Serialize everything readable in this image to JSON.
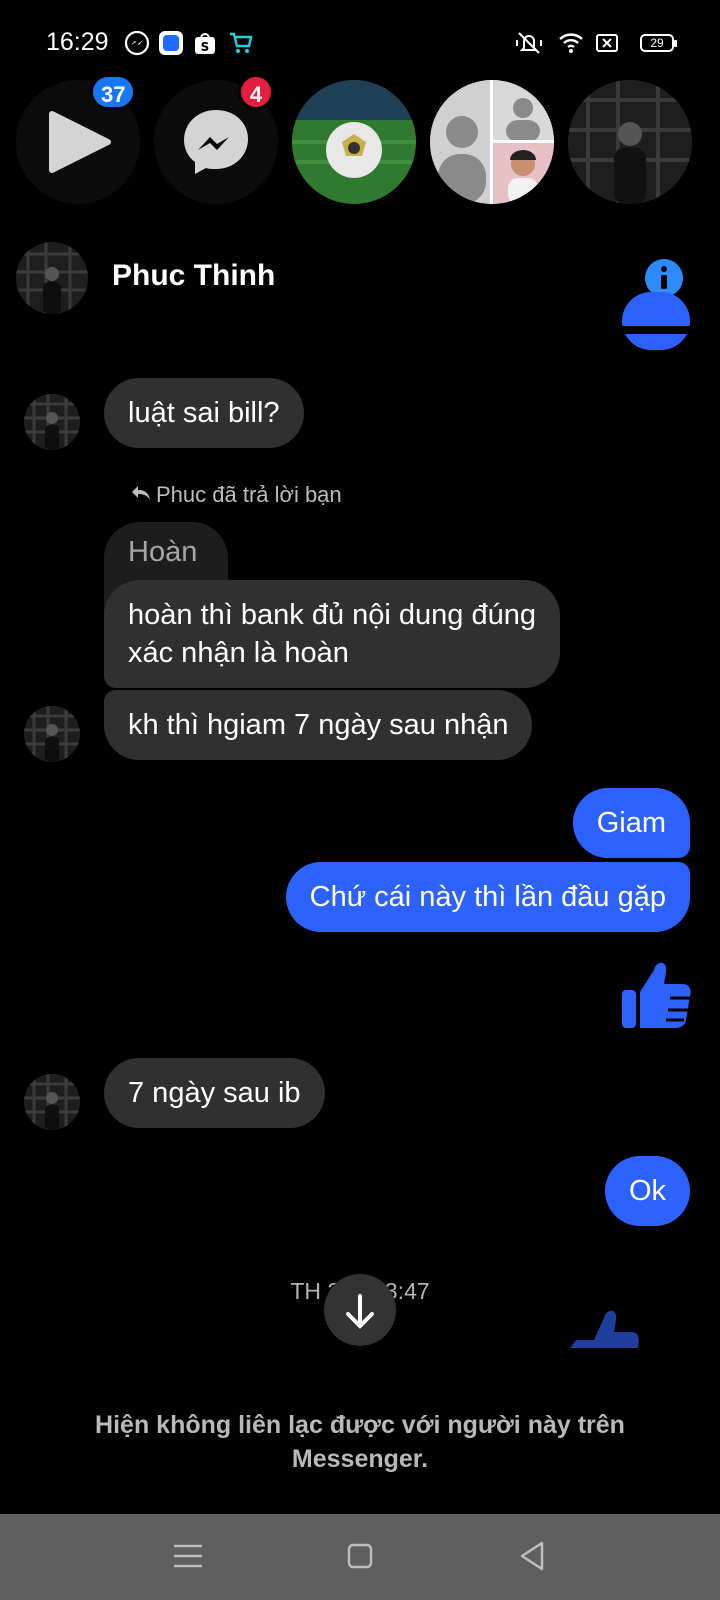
{
  "status_bar": {
    "time": "16:29",
    "battery": "29",
    "icons": [
      "messenger-icon",
      "blue-app-icon",
      "shopee-icon",
      "cart-icon",
      "mute-vibrate-icon",
      "wifi-icon",
      "sim-icon",
      "battery-icon"
    ]
  },
  "chat_heads": {
    "video_badge": "37",
    "messenger_badge": "4"
  },
  "header": {
    "name": "Phuc Thinh"
  },
  "messages": {
    "m1": "luật sai bill?",
    "reply_meta": "Phuc đã trả lời bạn",
    "quoted": "Hoàn",
    "m2_line1": "hoàn thì bank đủ nội dung đúng",
    "m2_line2": "xác nhận là hoàn",
    "m3": "kh thì hgiam 7 ngày sau nhận",
    "m4": "Giam",
    "m5": "Chứ cái này thì lần đầu gặp",
    "m6": "7 ngày sau ib",
    "m7": "Ok"
  },
  "timestamp": "TH 2 ... 13:47",
  "footer": {
    "unavailable_line1": "Hiện không liên lạc được với người này trên",
    "unavailable_line2": "Messenger."
  },
  "colors": {
    "accent": "#2e62ff",
    "incoming_bubble": "#303030",
    "badge_blue": "#1877f2",
    "badge_red": "#e41e3f"
  }
}
